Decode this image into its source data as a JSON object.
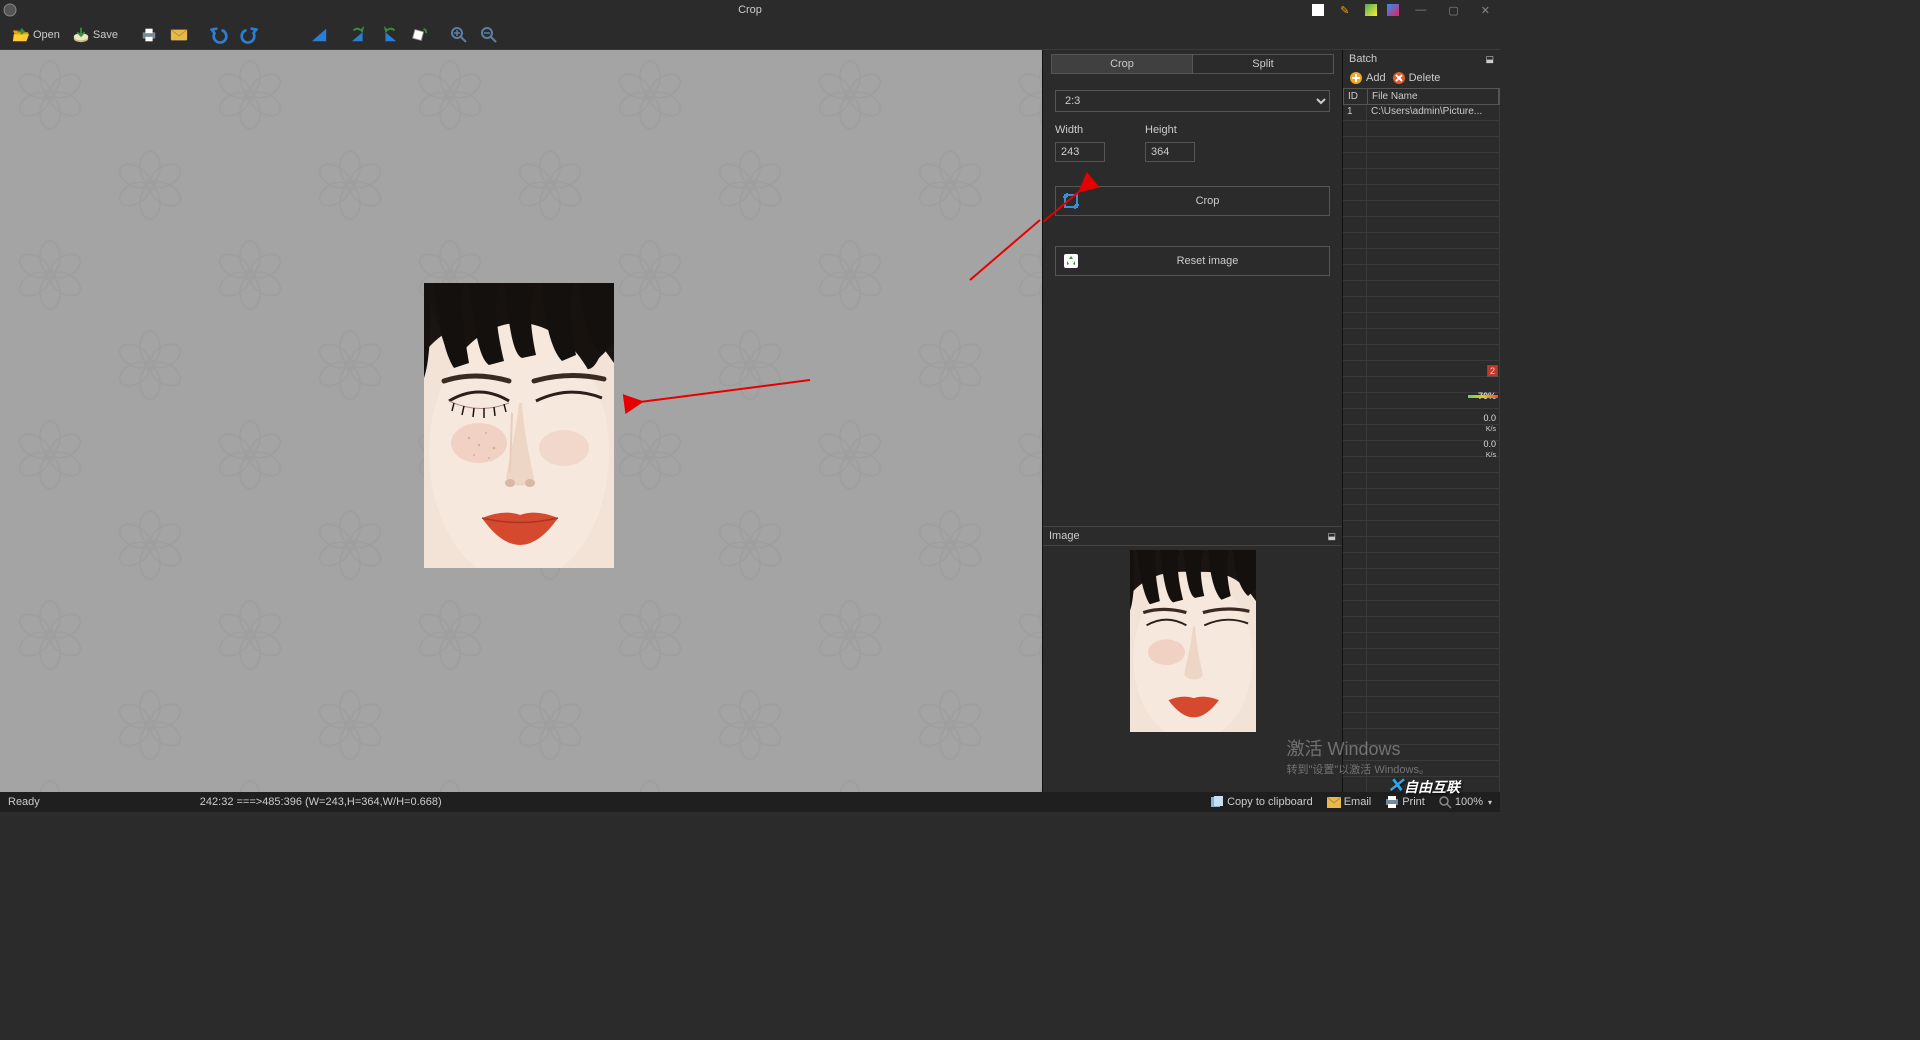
{
  "window": {
    "title": "Crop"
  },
  "toolbar": {
    "open_label": "Open",
    "save_label": "Save"
  },
  "tabs": {
    "crop": "Crop",
    "split": "Split"
  },
  "crop_panel": {
    "ratio_selected": "2:3",
    "width_label": "Width",
    "height_label": "Height",
    "width_value": "243",
    "height_value": "364",
    "crop_btn": "Crop",
    "reset_btn": "Reset image"
  },
  "preview": {
    "header": "Image"
  },
  "batch": {
    "header": "Batch",
    "add": "Add",
    "delete": "Delete",
    "col_id": "ID",
    "col_fn": "File Name",
    "rows": [
      {
        "id": "1",
        "fn": "C:\\Users\\admin\\Picture..."
      }
    ],
    "stray_badge": "2",
    "stray_percent": "70",
    "stray_rate1": "0.0",
    "stray_rate2": "0.0",
    "stray_unit": "K/s"
  },
  "status": {
    "ready": "Ready",
    "coords": "242:32 ===>485:396 (W=243,H=364,W/H=0.668)",
    "copy": "Copy to clipboard",
    "email": "Email",
    "print": "Print",
    "zoom": "100%"
  },
  "watermark": {
    "t1": "激活 Windows",
    "t2": "转到\"设置\"以激活 Windows。"
  },
  "brand": {
    "text": "自由互联"
  }
}
